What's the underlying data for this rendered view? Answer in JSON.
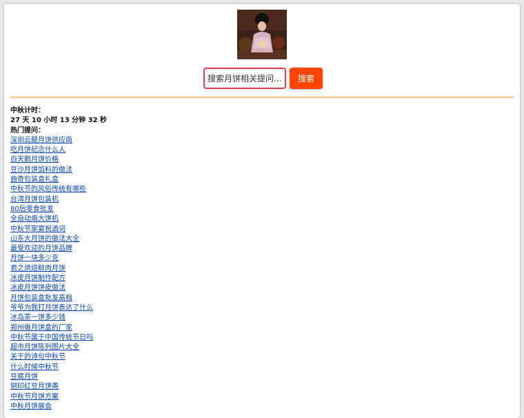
{
  "logo": {
    "alt": "logo"
  },
  "search": {
    "placeholder": "搜索月饼相关提问...",
    "button_label": "搜索"
  },
  "countdown": {
    "label": "中秋计时：",
    "value": "27 天 10 小时 13 分钟 32 秒"
  },
  "hot": {
    "label": "热门提问：",
    "items": [
      "深圳云腿月饼供应商",
      "吃月饼纪念什么人",
      "白天鹅月饼价格",
      "豆沙月饼馅料的做法",
      "曲奇包装盒礼盒",
      "中秋节的风俗传统有哪些",
      "台湾月饼包装机",
      "80后零食批发",
      "全自动烙大饼机",
      "中秋节家宴祝酒词",
      "山东大月饼的做法大全",
      "最受欢迎的月饼品牌",
      "月饼一块多少克",
      "君之烘焙鲜肉月饼",
      "冰皮月饼制作配方",
      "冰皮月饼饼皮做法",
      "月饼包装盒批发高档",
      "爷爷为我打月饼表达了什么",
      "冰岛茶一饼多少钱",
      "郑州做月饼盒的厂家",
      "中秋节属于中国传统节日吗",
      "超市月饼陈列图片大全",
      "关于的诗句中秋节",
      "什么时候中秋节",
      "豆腐月饼",
      "铜印红豆月饼斋",
      "中秋节月饼方案",
      "中秋月饼展会"
    ]
  }
}
